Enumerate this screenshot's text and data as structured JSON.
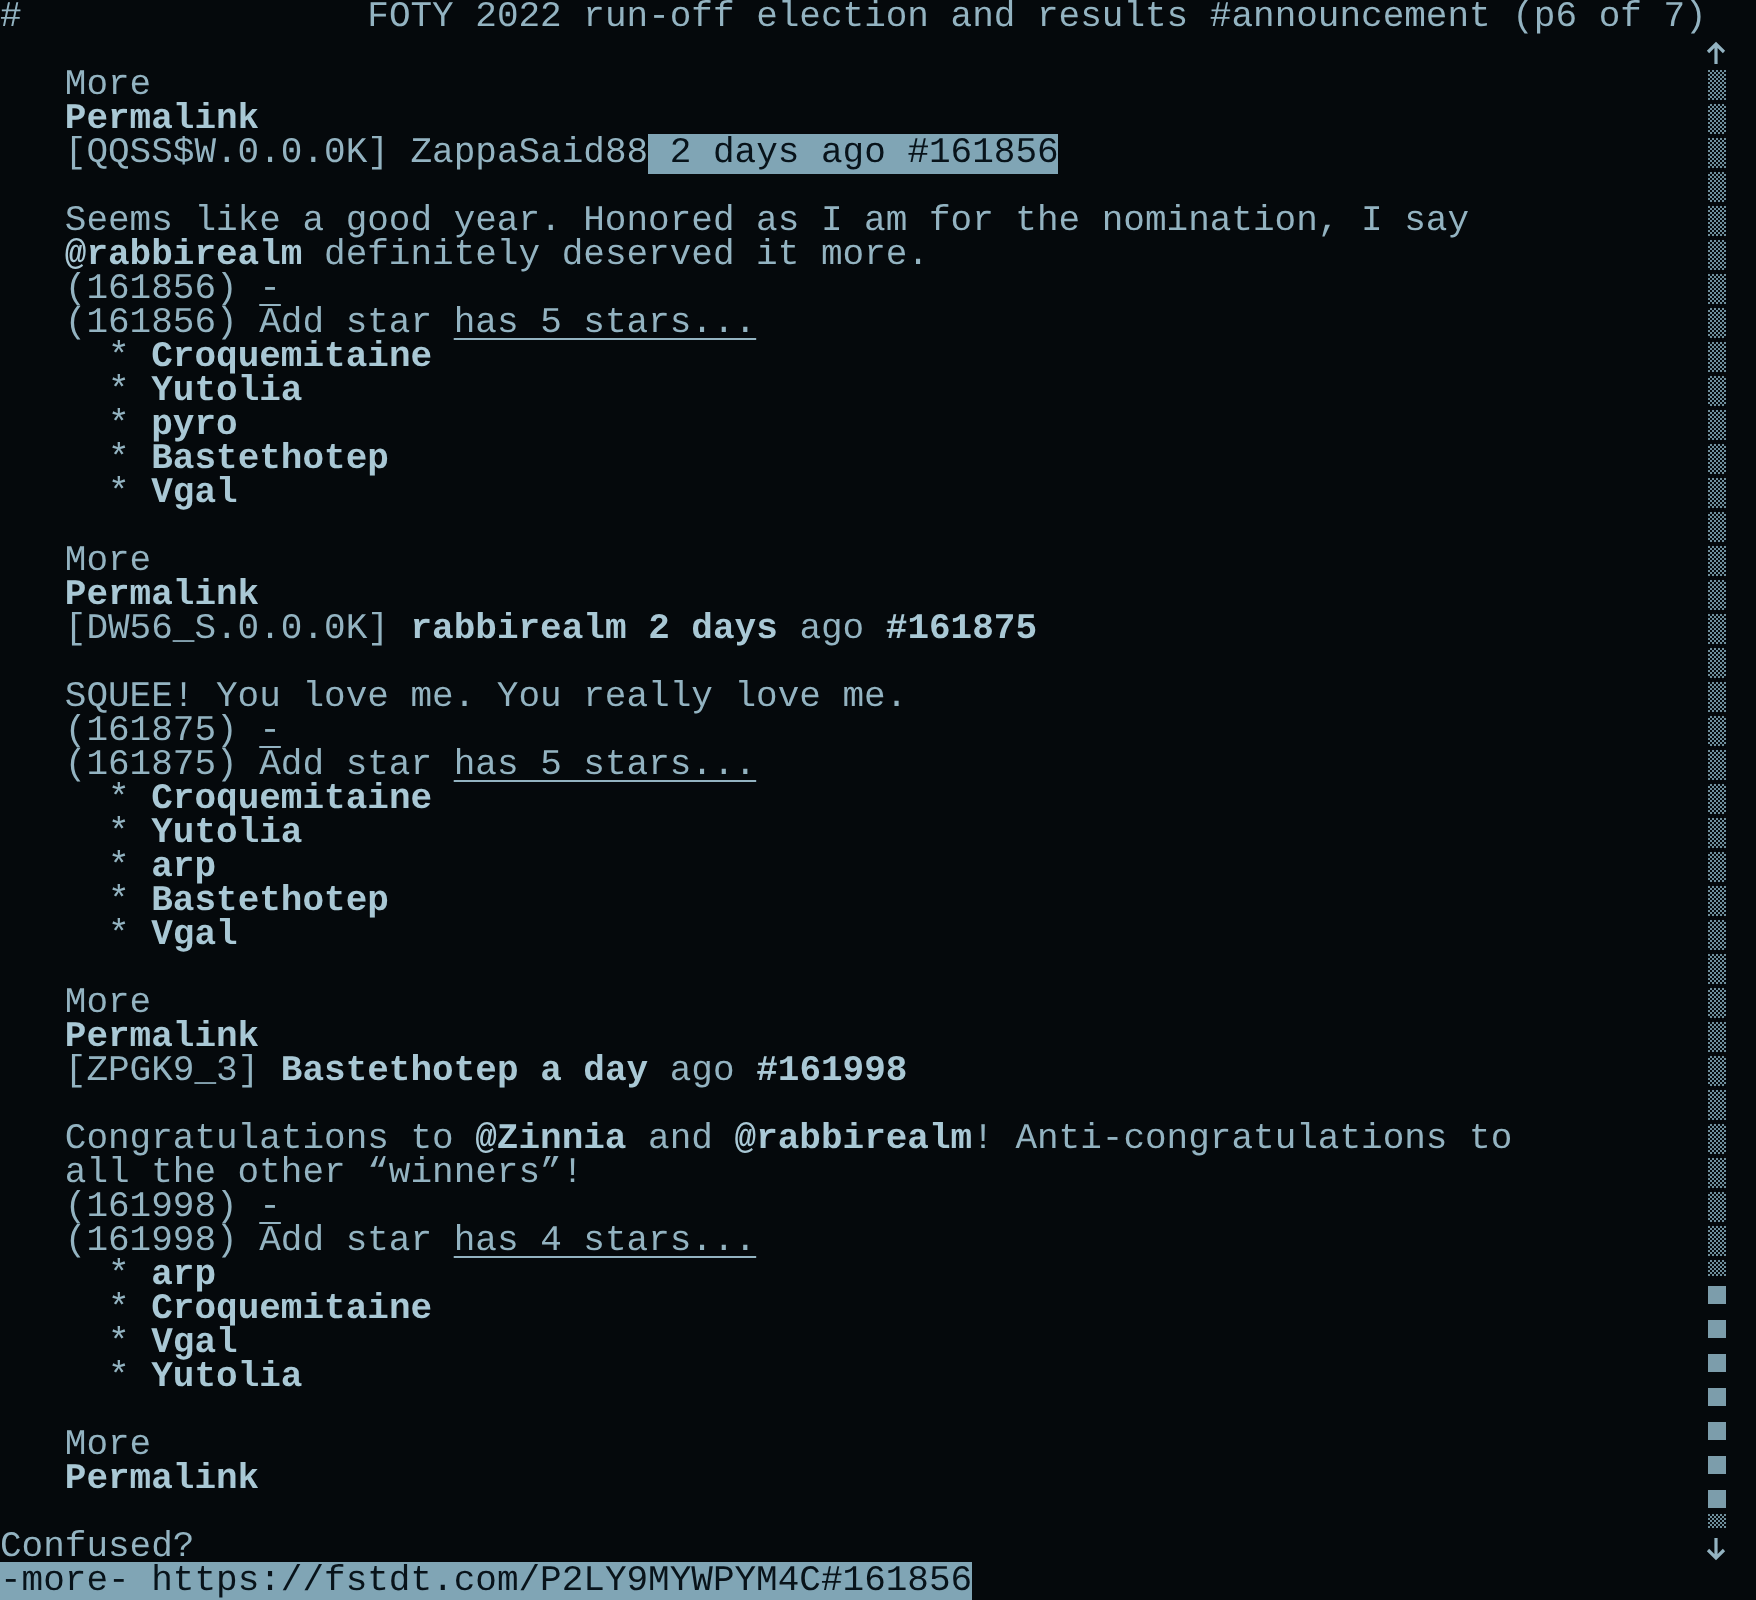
{
  "title_bar": {
    "marker": "#",
    "title": "FOTY 2022 run-off election and results #announcement (p6 of 7)"
  },
  "lead_links": [
    {
      "label": "More",
      "kind": "more"
    },
    {
      "label": "Permalink",
      "kind": "permalink"
    }
  ],
  "posts": [
    {
      "tag": "[QQSS$W.0.0.0K]",
      "author": "ZappaSaid88",
      "age": "**2 days** ago",
      "number": "#161856",
      "selected": true,
      "body": "Seems like a good year. Honored as I am for the nomination, I say **@rabbirealm** definitely deserved it more.",
      "ref": "(161856)",
      "star_ref": "(161856)",
      "collapse": "-",
      "add_star": "Add star",
      "star_count": "has 5 stars...",
      "stargazers": [
        {
          "bullet": "*",
          "name": "Croquemitaine"
        },
        {
          "bullet": "*",
          "name": "Yutolia"
        },
        {
          "bullet": "*",
          "name": "pyro"
        },
        {
          "bullet": "*",
          "name": "Bastethotep"
        },
        {
          "bullet": "*",
          "name": "Vgal"
        }
      ],
      "links": [
        {
          "label": "More",
          "kind": "more"
        },
        {
          "label": "Permalink",
          "kind": "permalink"
        }
      ]
    },
    {
      "tag": "[DW56_S.0.0.0K]",
      "author": "rabbirealm",
      "age": "**2 days** ago",
      "number": "#161875",
      "selected": false,
      "body": "SQUEE! You love me. You really love me.",
      "ref": "(161875)",
      "star_ref": "(161875)",
      "collapse": "-",
      "add_star": "Add star",
      "star_count": "has 5 stars...",
      "stargazers": [
        {
          "bullet": "*",
          "name": "Croquemitaine"
        },
        {
          "bullet": "*",
          "name": "Yutolia"
        },
        {
          "bullet": "*",
          "name": "arp"
        },
        {
          "bullet": "*",
          "name": "Bastethotep"
        },
        {
          "bullet": "*",
          "name": "Vgal"
        }
      ],
      "links": [
        {
          "label": "More",
          "kind": "more"
        },
        {
          "label": "Permalink",
          "kind": "permalink"
        }
      ]
    },
    {
      "tag": "[ZPGK9_3]",
      "author": "Bastethotep",
      "age": "**a day** ago",
      "number": "#161998",
      "selected": false,
      "body": "Congratulations to **@Zinnia** and **@rabbirealm**! Anti-congratulations to all the other “winners”!",
      "ref": "(161998)",
      "star_ref": "(161998)",
      "collapse": "-",
      "add_star": "Add star",
      "star_count": "has 4 stars...",
      "stargazers": [
        {
          "bullet": "*",
          "name": "arp"
        },
        {
          "bullet": "*",
          "name": "Croquemitaine"
        },
        {
          "bullet": "*",
          "name": "Vgal"
        },
        {
          "bullet": "*",
          "name": "Yutolia"
        }
      ],
      "links": [
        {
          "label": "More",
          "kind": "more"
        },
        {
          "label": "Permalink",
          "kind": "permalink"
        }
      ]
    }
  ],
  "status": {
    "message": "Confused?",
    "more": "-more-",
    "url": "https://fstdt.com/P2LY9MYWPYM4C#161856"
  }
}
